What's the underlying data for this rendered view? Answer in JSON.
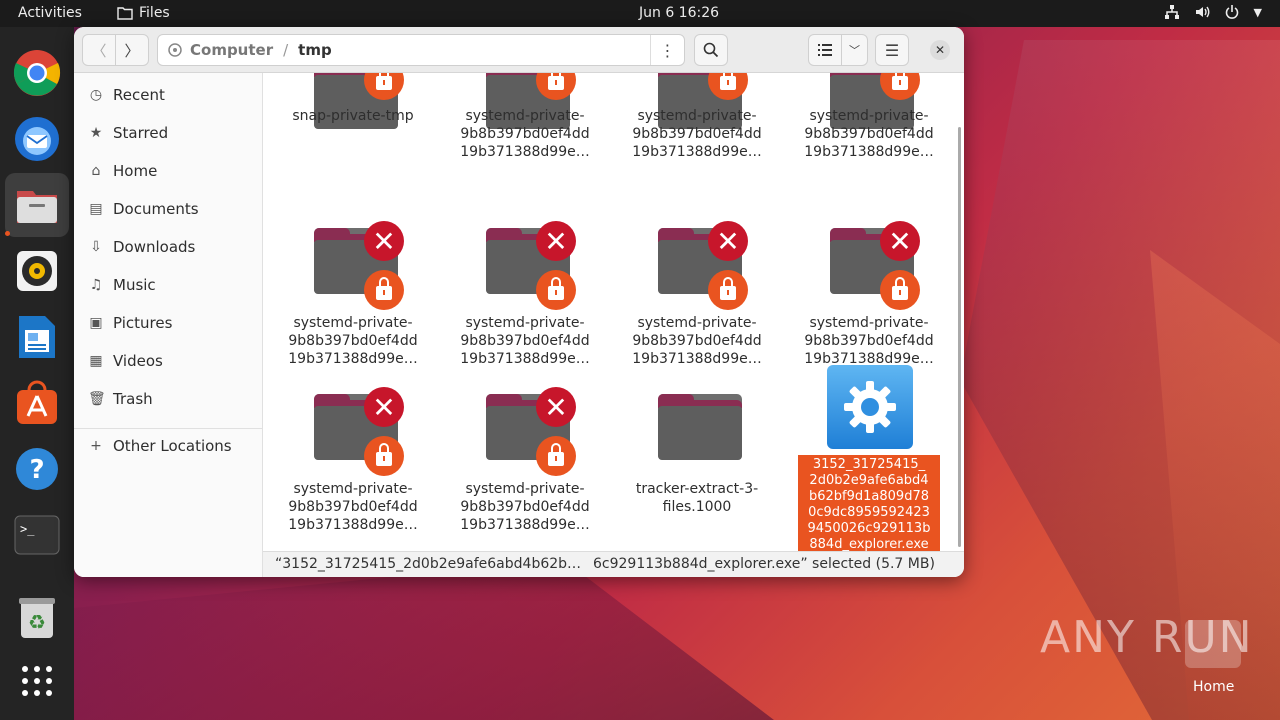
{
  "topbar": {
    "activities": "Activities",
    "app_name": "Files",
    "clock": "Jun 6  16:26"
  },
  "dock": {
    "items": [
      "Google Chrome",
      "Thunderbird Mail",
      "Files",
      "Rhythmbox",
      "LibreOffice Writer",
      "Ubuntu Software",
      "Help",
      "Terminal",
      "Trash",
      "Show Applications"
    ]
  },
  "window": {
    "path": {
      "root": "Computer",
      "sep": "/",
      "current": "tmp"
    },
    "sidebar": {
      "items": [
        {
          "label": "Recent",
          "icon": "clock-icon"
        },
        {
          "label": "Starred",
          "icon": "star-icon"
        },
        {
          "label": "Home",
          "icon": "home-icon"
        },
        {
          "label": "Documents",
          "icon": "document-icon"
        },
        {
          "label": "Downloads",
          "icon": "download-icon"
        },
        {
          "label": "Music",
          "icon": "music-icon"
        },
        {
          "label": "Pictures",
          "icon": "picture-icon"
        },
        {
          "label": "Videos",
          "icon": "video-icon"
        },
        {
          "label": "Trash",
          "icon": "trash-icon"
        }
      ],
      "other": "Other Locations"
    },
    "files": [
      {
        "l1": "snap-private-tmp",
        "l2": "",
        "l3": ""
      },
      {
        "l1": "systemd-private-",
        "l2": "9b8b397bd0ef4dd",
        "l3": "19b371388d99e…"
      },
      {
        "l1": "systemd-private-",
        "l2": "9b8b397bd0ef4dd",
        "l3": "19b371388d99e…"
      },
      {
        "l1": "systemd-private-",
        "l2": "9b8b397bd0ef4dd",
        "l3": "19b371388d99e…"
      },
      {
        "l1": "systemd-private-",
        "l2": "9b8b397bd0ef4dd",
        "l3": "19b371388d99e…"
      },
      {
        "l1": "systemd-private-",
        "l2": "9b8b397bd0ef4dd",
        "l3": "19b371388d99e…"
      },
      {
        "l1": "systemd-private-",
        "l2": "9b8b397bd0ef4dd",
        "l3": "19b371388d99e…"
      },
      {
        "l1": "systemd-private-",
        "l2": "9b8b397bd0ef4dd",
        "l3": "19b371388d99e…"
      },
      {
        "l1": "systemd-private-",
        "l2": "9b8b397bd0ef4dd",
        "l3": "19b371388d99e…"
      },
      {
        "l1": "systemd-private-",
        "l2": "9b8b397bd0ef4dd",
        "l3": "19b371388d99e…"
      },
      {
        "l1": "tracker-extract-3-",
        "l2": "files.1000",
        "l3": ""
      }
    ],
    "selected_file": {
      "lines": [
        "3152_31725415_",
        "2d0b2e9afe6abd4",
        "b62bf9d1a809d78",
        "0c9dc8959592423",
        "9450026c929113b",
        "884d_explorer.exe"
      ]
    },
    "status": {
      "left": "“3152_31725415_2d0b2e9afe6abd4b62b…",
      "right": "6c929113b884d_explorer.exe” selected  (5.7 MB)"
    }
  },
  "desktop": {
    "watermark": "ANY RUN",
    "home_label": "Home"
  }
}
